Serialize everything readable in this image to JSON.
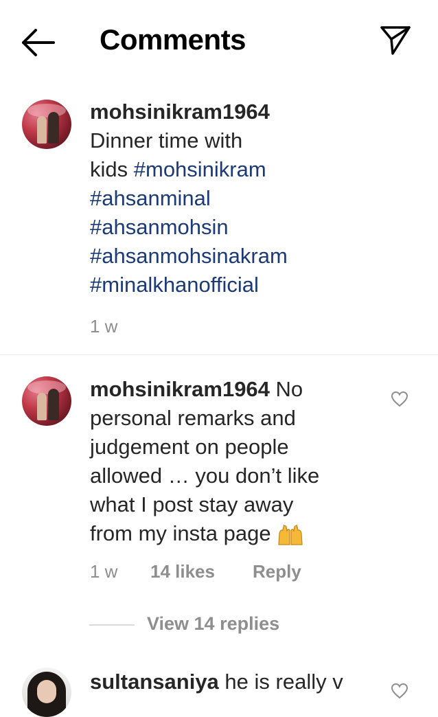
{
  "header": {
    "title": "Comments",
    "back_icon": "arrow-left-icon",
    "send_icon": "paper-plane-icon"
  },
  "caption": {
    "username": "mohsinikram1964",
    "text_line1": "Dinner time with",
    "text_line2_prefix": "kids ",
    "hashtags": [
      "#mohsinikram",
      "#ahsanminal",
      "#ahsanmohsin",
      "#ahsanmohsinakram",
      "#minalkhanofficial"
    ],
    "time": "1 w",
    "hashtag_color": "#1b3a77"
  },
  "comments": [
    {
      "username": "mohsinikram1964",
      "text_lines": [
        " No",
        "personal remarks and",
        "judgement on people",
        "allowed … you don’t like",
        "what I post stay away",
        "from my insta page "
      ],
      "emoji": "raising-hands-emoji",
      "time": "1 w",
      "likes": "14 likes",
      "reply_label": "Reply",
      "view_replies": "View 14 replies"
    },
    {
      "username": "sultansaniya",
      "text": " he is really v"
    }
  ]
}
